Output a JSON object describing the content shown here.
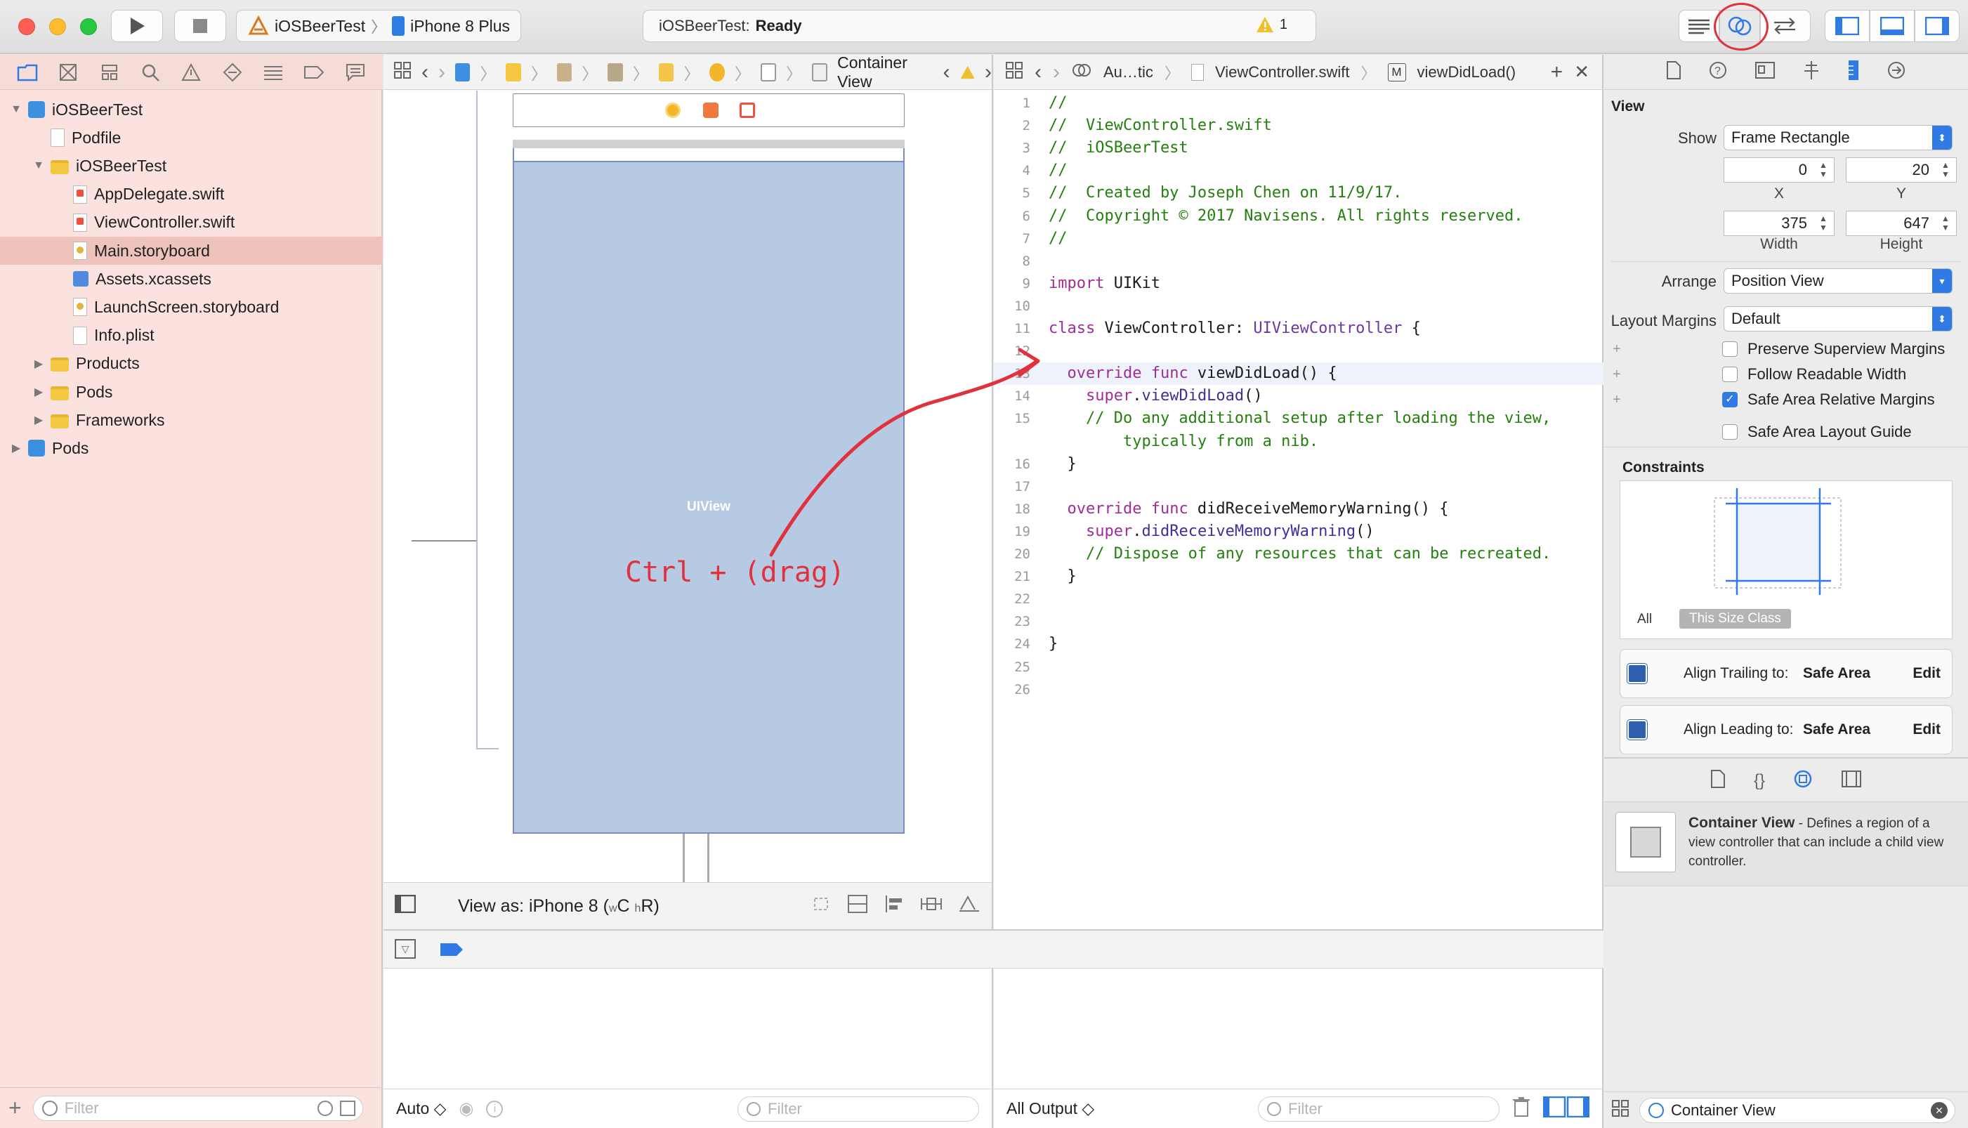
{
  "toolbar": {
    "scheme_name": "iOSBeerTest",
    "device_name": "iPhone 8 Plus",
    "status_app": "iOSBeerTest:",
    "status_state": "Ready",
    "warning_count": "1"
  },
  "navigator": {
    "items": [
      {
        "label": "iOSBeerTest",
        "depth": 0,
        "disclosure": "▼",
        "icon": "project-icon"
      },
      {
        "label": "Podfile",
        "depth": 1,
        "disclosure": "",
        "icon": "file-icon"
      },
      {
        "label": "iOSBeerTest",
        "depth": 1,
        "disclosure": "▼",
        "icon": "folder-icon"
      },
      {
        "label": "AppDelegate.swift",
        "depth": 2,
        "disclosure": "",
        "icon": "swift-file-icon"
      },
      {
        "label": "ViewController.swift",
        "depth": 2,
        "disclosure": "",
        "icon": "swift-file-icon"
      },
      {
        "label": "Main.storyboard",
        "depth": 2,
        "disclosure": "",
        "icon": "storyboard-icon",
        "selected": true
      },
      {
        "label": "Assets.xcassets",
        "depth": 2,
        "disclosure": "",
        "icon": "assets-icon"
      },
      {
        "label": "LaunchScreen.storyboard",
        "depth": 2,
        "disclosure": "",
        "icon": "storyboard-icon"
      },
      {
        "label": "Info.plist",
        "depth": 2,
        "disclosure": "",
        "icon": "file-icon"
      },
      {
        "label": "Products",
        "depth": 1,
        "disclosure": "▶",
        "icon": "folder-icon"
      },
      {
        "label": "Pods",
        "depth": 1,
        "disclosure": "▶",
        "icon": "folder-icon"
      },
      {
        "label": "Frameworks",
        "depth": 1,
        "disclosure": "▶",
        "icon": "folder-icon"
      },
      {
        "label": "Pods",
        "depth": 0,
        "disclosure": "▶",
        "icon": "project-icon"
      }
    ],
    "filter_placeholder": "Filter"
  },
  "ib": {
    "jumpbar_last": "Container View",
    "uiview_label": "UIView",
    "annotation": "Ctrl + (drag)",
    "view_as_prefix": "View as: iPhone 8 (",
    "view_as_w": "w",
    "view_as_c": "C",
    "view_as_h": "h",
    "view_as_r": "R",
    "view_as_suffix": ")",
    "accent_color": "#e0323c"
  },
  "editor": {
    "jumpbar": {
      "auto": "Au…tic",
      "file": "ViewController.swift",
      "method_badge": "M",
      "method": "viewDidLoad()"
    },
    "lines": [
      {
        "n": "1",
        "segs": [
          [
            "cm",
            "//"
          ]
        ]
      },
      {
        "n": "2",
        "segs": [
          [
            "cm",
            "//  ViewController.swift"
          ]
        ]
      },
      {
        "n": "3",
        "segs": [
          [
            "cm",
            "//  iOSBeerTest"
          ]
        ]
      },
      {
        "n": "4",
        "segs": [
          [
            "cm",
            "//"
          ]
        ]
      },
      {
        "n": "5",
        "segs": [
          [
            "cm",
            "//  Created by Joseph Chen on 11/9/17."
          ]
        ]
      },
      {
        "n": "6",
        "segs": [
          [
            "cm",
            "//  Copyright © 2017 Navisens. All rights reserved."
          ]
        ]
      },
      {
        "n": "7",
        "segs": [
          [
            "cm",
            "//"
          ]
        ]
      },
      {
        "n": "8",
        "segs": []
      },
      {
        "n": "9",
        "segs": [
          [
            "kw",
            "import"
          ],
          [
            "pl",
            " UIKit"
          ]
        ]
      },
      {
        "n": "10",
        "segs": []
      },
      {
        "n": "11",
        "segs": [
          [
            "kw",
            "class"
          ],
          [
            "pl",
            " ViewController: "
          ],
          [
            "ty",
            "UIViewController"
          ],
          [
            "pl",
            " {"
          ]
        ]
      },
      {
        "n": "12",
        "segs": []
      },
      {
        "n": "13",
        "segs": [
          [
            "pl",
            "  "
          ],
          [
            "kw",
            "override func"
          ],
          [
            "pl",
            " viewDidLoad() {"
          ]
        ],
        "current": true
      },
      {
        "n": "14",
        "segs": [
          [
            "pl",
            "    "
          ],
          [
            "kw",
            "super"
          ],
          [
            "pl",
            "."
          ],
          [
            "fn",
            "viewDidLoad"
          ],
          [
            "pl",
            "()"
          ]
        ]
      },
      {
        "n": "15",
        "segs": [
          [
            "pl",
            "    "
          ],
          [
            "cm",
            "// Do any additional setup after loading the view,"
          ]
        ]
      },
      {
        "n": "",
        "segs": [
          [
            "pl",
            "        "
          ],
          [
            "cm",
            "typically from a nib."
          ]
        ]
      },
      {
        "n": "16",
        "segs": [
          [
            "pl",
            "  }"
          ]
        ]
      },
      {
        "n": "17",
        "segs": []
      },
      {
        "n": "18",
        "segs": [
          [
            "pl",
            "  "
          ],
          [
            "kw",
            "override func"
          ],
          [
            "pl",
            " didReceiveMemoryWarning() {"
          ]
        ]
      },
      {
        "n": "19",
        "segs": [
          [
            "pl",
            "    "
          ],
          [
            "kw",
            "super"
          ],
          [
            "pl",
            "."
          ],
          [
            "fn",
            "didReceiveMemoryWarning"
          ],
          [
            "pl",
            "()"
          ]
        ]
      },
      {
        "n": "20",
        "segs": [
          [
            "pl",
            "    "
          ],
          [
            "cm",
            "// Dispose of any resources that can be recreated."
          ]
        ]
      },
      {
        "n": "21",
        "segs": [
          [
            "pl",
            "  }"
          ]
        ]
      },
      {
        "n": "22",
        "segs": []
      },
      {
        "n": "23",
        "segs": []
      },
      {
        "n": "24",
        "segs": [
          [
            "pl",
            "}"
          ]
        ]
      },
      {
        "n": "25",
        "segs": []
      },
      {
        "n": "26",
        "segs": []
      }
    ]
  },
  "debug": {
    "vars_mode": "Auto ◇",
    "filter_placeholder": "Filter",
    "console_mode": "All Output ◇"
  },
  "inspector": {
    "section_title": "View",
    "show_label": "Show",
    "show_value": "Frame Rectangle",
    "x_value": "0",
    "y_value": "20",
    "x_label": "X",
    "y_label": "Y",
    "width_value": "375",
    "height_value": "647",
    "width_label": "Width",
    "height_label": "Height",
    "arrange_label": "Arrange",
    "arrange_value": "Position View",
    "margins_label": "Layout Margins",
    "margins_value": "Default",
    "checkboxes": [
      {
        "label": "Preserve Superview Margins",
        "checked": false,
        "plus": true
      },
      {
        "label": "Follow Readable Width",
        "checked": false,
        "plus": true
      },
      {
        "label": "Safe Area Relative Margins",
        "checked": true,
        "plus": true
      },
      {
        "label": "Safe Area Layout Guide",
        "checked": false,
        "plus": false
      }
    ],
    "constraints_title": "Constraints",
    "seg_all": "All",
    "seg_size_class": "This Size Class",
    "constraint_rows": [
      {
        "label": "Align Trailing to:",
        "target": "Safe Area",
        "edit": "Edit"
      },
      {
        "label": "Align Leading to:",
        "target": "Safe Area",
        "edit": "Edit"
      }
    ],
    "library_item_title": "Container View",
    "library_item_desc": " - Defines a region of a view controller that can include a child view controller.",
    "library_filter_value": "Container View"
  }
}
